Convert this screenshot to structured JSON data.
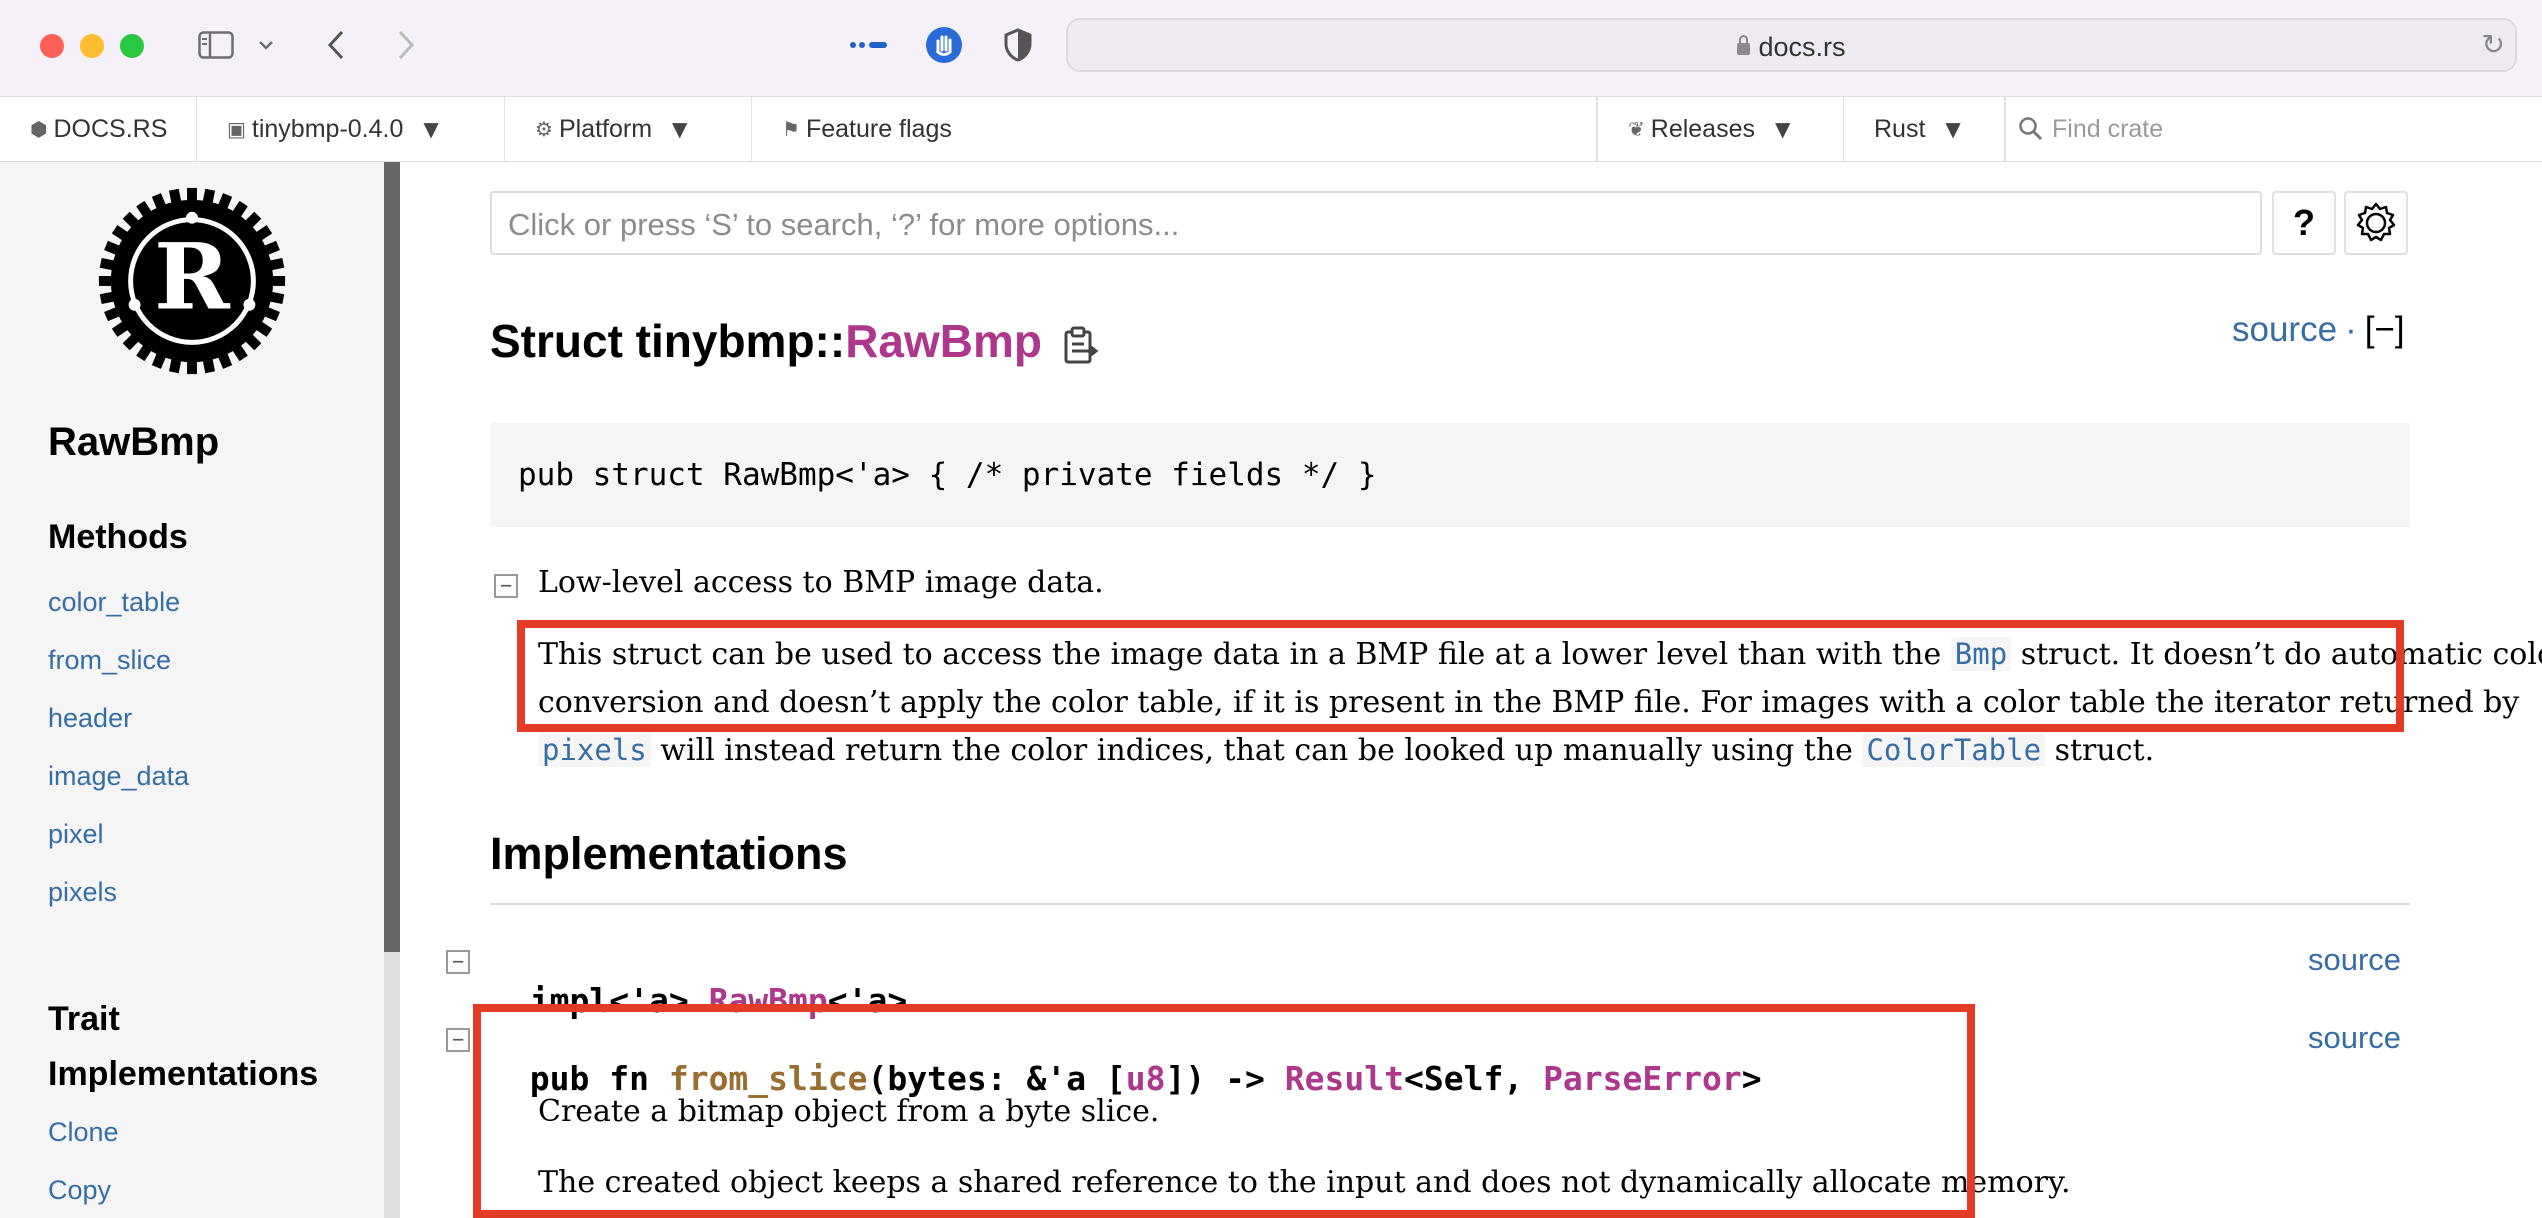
{
  "browser": {
    "url_host": "docs.rs",
    "icons": [
      "close-dot",
      "minimize-dot",
      "zoom-dot",
      "sidebar-icon",
      "chevron-down-icon",
      "back-icon",
      "forward-icon",
      "dots-icon",
      "hand-icon",
      "shield-icon",
      "lock-icon",
      "reload-icon"
    ]
  },
  "topnav": {
    "logo_label": "DOCS.RS",
    "crate_label": "tinybmp-0.4.0",
    "platform_label": "Platform",
    "feature_flags_label": "Feature flags",
    "releases_label": "Releases",
    "rust_label": "Rust",
    "find_crate_placeholder": "Find crate"
  },
  "sidebar": {
    "item_title": "RawBmp",
    "methods_heading": "Methods",
    "methods": [
      "color_table",
      "from_slice",
      "header",
      "image_data",
      "pixel",
      "pixels"
    ],
    "trait_heading_line1": "Trait",
    "trait_heading_line2": "Implementations",
    "traits": [
      "Clone",
      "Copy"
    ]
  },
  "search": {
    "placeholder": "Click or press ‘S’ to search, ‘?’ for more options...",
    "help_label": "?"
  },
  "header": {
    "title_prefix": "Struct tinybmp::",
    "title_name": "RawBmp",
    "source_label": "source",
    "separator": "·",
    "collapse_label": "[−]"
  },
  "declaration": "pub struct RawBmp<'a> { /* private fields */ }",
  "docs": {
    "summary": "Low-level access to BMP image data.",
    "p1_line1_a": "This struct can be used to access the image data in a BMP file at a lower level than with the ",
    "p1_line1_code": "Bmp",
    "p1_line1_b": " struct. It doesn’t do automatic color",
    "p1_line2": "conversion and doesn’t apply the color table, if it is present in the BMP file. For images with a color table the iterator returned by",
    "p1_line3_code1": "pixels",
    "p1_line3_a": " will instead return the color indices, that can be looked up manually using the ",
    "p1_line3_code2": "ColorTable",
    "p1_line3_b": " struct."
  },
  "implementations": {
    "heading": "Implementations",
    "impl_prefix": "impl<'a> ",
    "impl_type": "RawBmp",
    "impl_suffix": "<'a>",
    "source_label": "source",
    "fn": {
      "prefix": "pub fn ",
      "name": "from_slice",
      "args_a": "(bytes: &'a [",
      "u8": "u8",
      "args_b": "]) -> ",
      "result": "Result",
      "self_part": "<Self, ",
      "error": "ParseError",
      "close": ">",
      "desc1": "Create a bitmap object from a byte slice.",
      "desc2": "The created object keeps a shared reference to the input and does not dynamically allocate memory."
    }
  },
  "colors": {
    "link": "#356da4",
    "type": "#ad378a",
    "fn": "#9a6e31",
    "highlight_box": "#e33b26"
  }
}
